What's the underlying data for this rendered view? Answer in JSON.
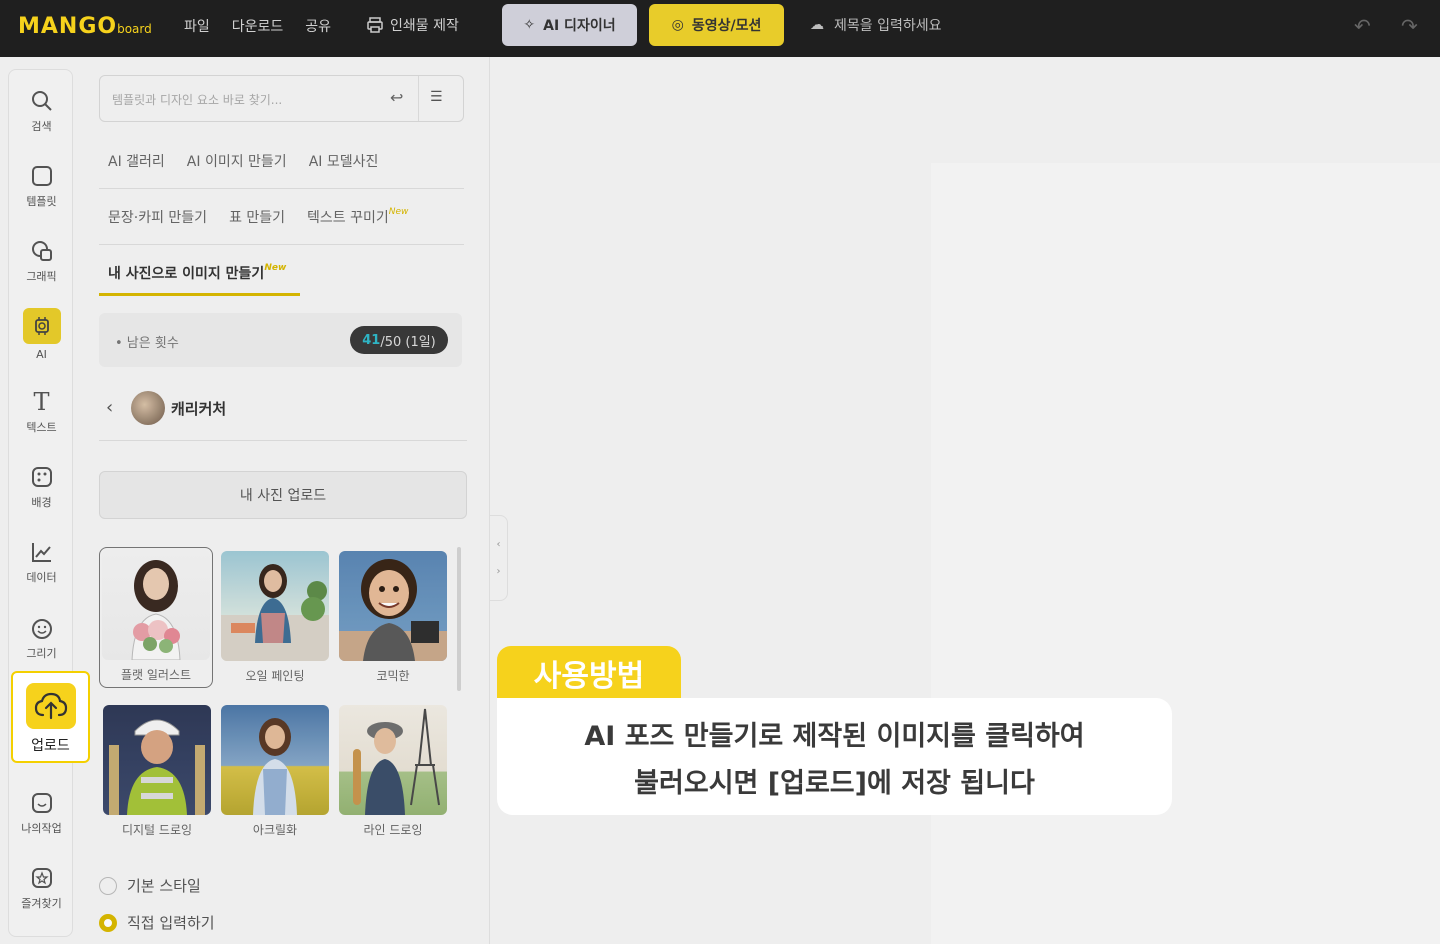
{
  "topbar": {
    "logo_main": "MANGO",
    "logo_sub": "board",
    "menu": [
      "파일",
      "다운로드",
      "공유"
    ],
    "print": "인쇄물 제작",
    "ai_designer": "AI 디자이너",
    "video_motion": "동영상/모션",
    "title_placeholder": "제목을 입력하세요",
    "undo": "↶",
    "redo": "↷"
  },
  "rail": [
    {
      "label": "검색",
      "icon": "search-icon",
      "glyph": "⌕"
    },
    {
      "label": "템플릿",
      "icon": "template-icon",
      "glyph": "▢"
    },
    {
      "label": "그래픽",
      "icon": "graphic-icon",
      "glyph": "◇"
    },
    {
      "label": "AI",
      "icon": "ai-chip-icon",
      "glyph": "⚙"
    },
    {
      "label": "텍스트",
      "icon": "text-icon",
      "glyph": "T"
    },
    {
      "label": "배경",
      "icon": "background-icon",
      "glyph": "▦"
    },
    {
      "label": "데이터",
      "icon": "chart-icon",
      "glyph": "↗"
    },
    {
      "label": "그리기",
      "icon": "draw-icon",
      "glyph": "☺"
    },
    {
      "label": "업로드",
      "icon": "upload-cloud-icon",
      "glyph": "☁"
    },
    {
      "label": "나의작업",
      "icon": "my-work-icon",
      "glyph": "☺"
    },
    {
      "label": "즐겨찾기",
      "icon": "favorite-icon",
      "glyph": "☆"
    }
  ],
  "panel": {
    "search_placeholder": "템플릿과 디자인 요소 바로 찾기...",
    "tabs_row1": [
      "AI 갤러리",
      "AI 이미지 만들기",
      "AI 모델사진"
    ],
    "tabs_row2": [
      "문장·카피 만들기",
      "표 만들기",
      "텍스트 꾸미기"
    ],
    "tab_active": "내 사진으로 이미지 만들기",
    "new_badge": "New",
    "remaining_label": "• 남은 횟수",
    "remaining_used": "41",
    "remaining_rest": "/50 (1일)",
    "back_title": "캐리커처",
    "upload_button": "내 사진 업로드",
    "styles": [
      "플랫 일러스트",
      "오일 페인팅",
      "코믹한",
      "디지털 드로잉",
      "아크릴화",
      "라인 드로잉"
    ],
    "radio_basic": "기본 스타일",
    "radio_direct": "직접 입력하기"
  },
  "overlay": {
    "upload_label": "업로드",
    "tip_tab": "사용방법",
    "tip_line1": "AI 포즈 만들기로 제작된 이미지를 클릭하여",
    "tip_line2": "불러오시면 [업로드]에 저장 됩니다"
  },
  "colors": {
    "accent": "#f6d21c",
    "topbar": "#1f1f1f"
  }
}
